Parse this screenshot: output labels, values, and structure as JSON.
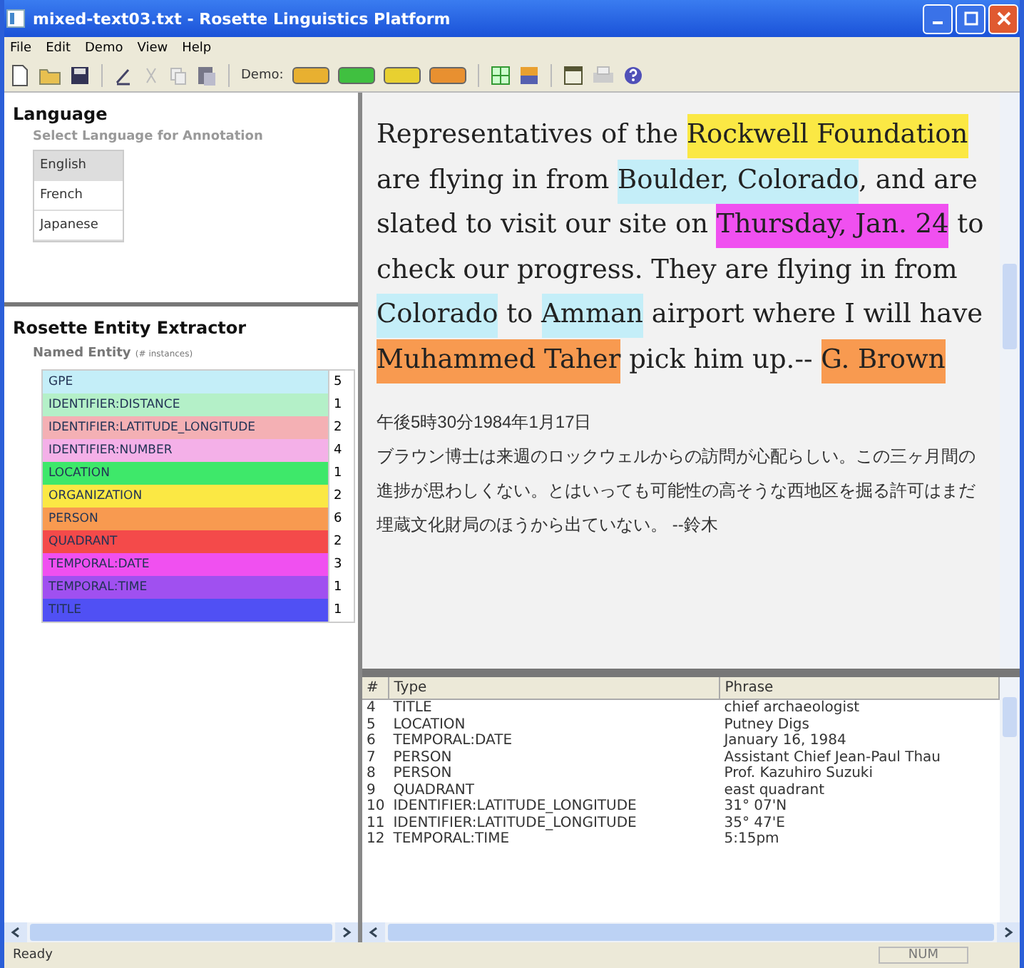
{
  "window": {
    "title": "mixed-text03.txt - Rosette Linguistics Platform"
  },
  "menu": [
    "File",
    "Edit",
    "Demo",
    "View",
    "Help"
  ],
  "toolbar": {
    "demo_label": "Demo:"
  },
  "language": {
    "title": "Language",
    "subtitle": "Select Language for Annotation",
    "options": [
      {
        "label": "English",
        "selected": true
      },
      {
        "label": "French",
        "selected": false
      },
      {
        "label": "Japanese",
        "selected": false
      }
    ]
  },
  "extractor": {
    "title": "Rosette Entity Extractor",
    "subtitle": "Named Entity",
    "subtitle_note": "(# instances)",
    "entities": [
      {
        "name": "GPE",
        "count": "5",
        "color": "#c4eef8"
      },
      {
        "name": "IDENTIFIER:DISTANCE",
        "count": "1",
        "color": "#b4f0c8"
      },
      {
        "name": "IDENTIFIER:LATITUDE_LONGITUDE",
        "count": "2",
        "color": "#f4b0b4"
      },
      {
        "name": "IDENTIFIER:NUMBER",
        "count": "4",
        "color": "#f4b0e8"
      },
      {
        "name": "LOCATION",
        "count": "1",
        "color": "#3ee86a"
      },
      {
        "name": "ORGANIZATION",
        "count": "2",
        "color": "#fbe844"
      },
      {
        "name": "PERSON",
        "count": "6",
        "color": "#f89a50"
      },
      {
        "name": "QUADRANT",
        "count": "2",
        "color": "#f44a4a"
      },
      {
        "name": "TEMPORAL:DATE",
        "count": "3",
        "color": "#f050f0"
      },
      {
        "name": "TEMPORAL:TIME",
        "count": "1",
        "color": "#a050f0"
      },
      {
        "name": "TITLE",
        "count": "1",
        "color": "#5050f4"
      }
    ]
  },
  "document": {
    "segments": [
      {
        "text": "Representatives of the "
      },
      {
        "text": "Rockwell Foundation",
        "color": "#fbe844"
      },
      {
        "text": " are flying in from "
      },
      {
        "text": "Boulder, Colorado",
        "color": "#c4eef8"
      },
      {
        "text": ", and are slated to visit our site on "
      },
      {
        "text": "Thursday, Jan. 24",
        "color": "#f050f0"
      },
      {
        "text": " to check our progress. They are flying in from "
      },
      {
        "text": "Colorado",
        "color": "#c4eef8"
      },
      {
        "text": " to "
      },
      {
        "text": "Amman",
        "color": "#c4eef8"
      },
      {
        "text": " airport where I will have  "
      },
      {
        "text": "Muhammed Taher",
        "color": "#f89a50"
      },
      {
        "text": " pick him up.-- "
      },
      {
        "text": "G. Brown",
        "color": "#f89a50"
      }
    ],
    "japanese": [
      "午後5時30分1984年1月17日",
      "ブラウン博士は来週のロックウェルからの訪問が心配らしい。この三ヶ月間の進捗が思わしくない。とはいっても可能性の高そうな西地区を掘る許可はまだ埋蔵文化財局のほうから出ていない。 --鈴木"
    ]
  },
  "results": {
    "columns": [
      "#",
      "Type",
      "Phrase"
    ],
    "rows": [
      [
        "4",
        "TITLE",
        "chief archaeologist"
      ],
      [
        "5",
        "LOCATION",
        "Putney Digs"
      ],
      [
        "6",
        "TEMPORAL:DATE",
        "January 16, 1984"
      ],
      [
        "7",
        "PERSON",
        "Assistant Chief Jean-Paul Thau"
      ],
      [
        "8",
        "PERSON",
        "Prof. Kazuhiro Suzuki"
      ],
      [
        "9",
        "QUADRANT",
        "east quadrant"
      ],
      [
        "10",
        "IDENTIFIER:LATITUDE_LONGITUDE",
        "31°  07'N"
      ],
      [
        "11",
        "IDENTIFIER:LATITUDE_LONGITUDE",
        "35°  47'E"
      ],
      [
        "12",
        "TEMPORAL:TIME",
        "5:15pm"
      ]
    ]
  },
  "status_bar": {
    "message": "Ready",
    "indicator": "NUM"
  }
}
